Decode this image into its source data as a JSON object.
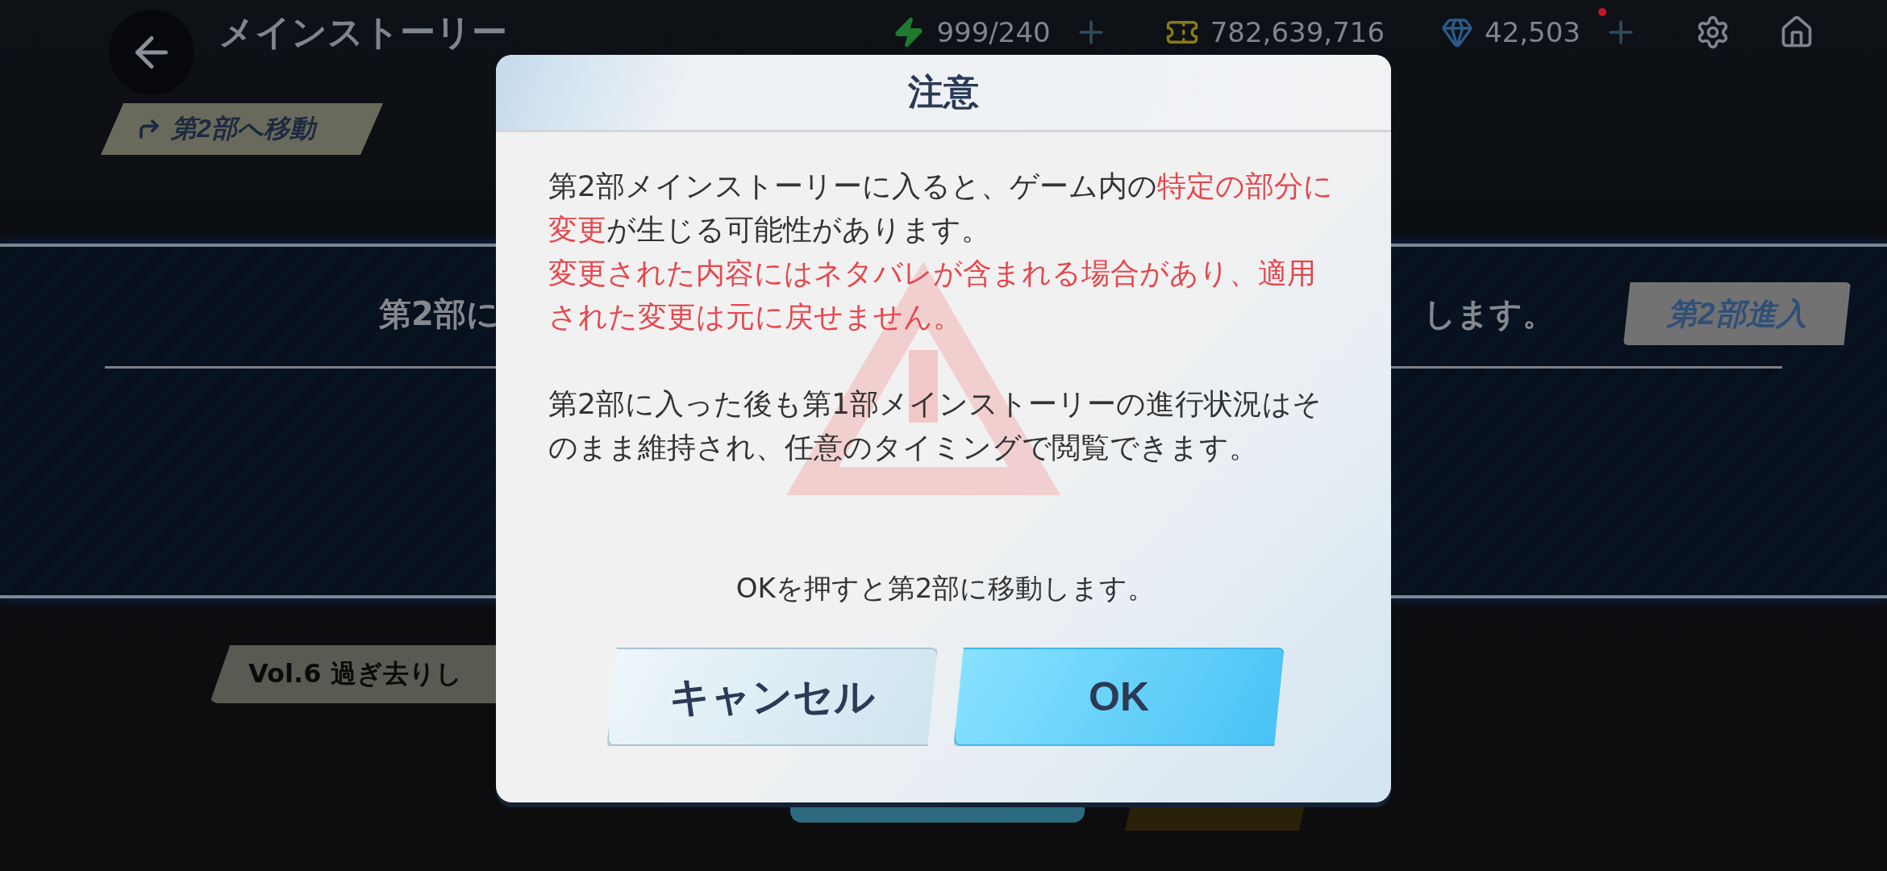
{
  "top_bar": {
    "title": "メインストーリー",
    "resources": [
      {
        "kind": "stamina",
        "value": "999/240",
        "addable": true,
        "notice": false
      },
      {
        "kind": "coins",
        "value": "782,639,716",
        "addable": false,
        "notice": false
      },
      {
        "kind": "crystals",
        "value": "42,503",
        "addable": true,
        "notice": true
      }
    ]
  },
  "move_link": "第2部へ移動",
  "part2_row": {
    "text_before": "第2部に",
    "text_after": "します。",
    "button": "第2部進入"
  },
  "episode": {
    "title": "Vol.6 過ぎ去りし"
  },
  "dialog": {
    "title": "注意",
    "sections": [
      {
        "sentences": [
          {
            "segments": [
              {
                "text": "第2部メインストーリーに入ると、ゲーム内の",
                "highlight": false
              },
              {
                "text": "特定の部分に変更",
                "highlight": true
              },
              {
                "text": "が生じる可能性があります。",
                "highlight": false
              }
            ]
          },
          {
            "segments": [
              {
                "text": "変更された内容にはネタバレが含まれる場合があり、適用された変更は元に戻せません。",
                "highlight": true
              }
            ]
          }
        ]
      },
      {
        "sentences": [
          {
            "segments": [
              {
                "text": "第2部に入った後も第1部メインストーリーの進行状況はそのまま維持され、任意のタイミングで閲覧できます。",
                "highlight": false
              }
            ]
          }
        ]
      }
    ],
    "confirm_note": "OKを押すと第2部に移動します。",
    "buttons": [
      {
        "label": "キャンセル",
        "kind": "cancel"
      },
      {
        "label": "OK",
        "kind": "ok"
      }
    ]
  }
}
